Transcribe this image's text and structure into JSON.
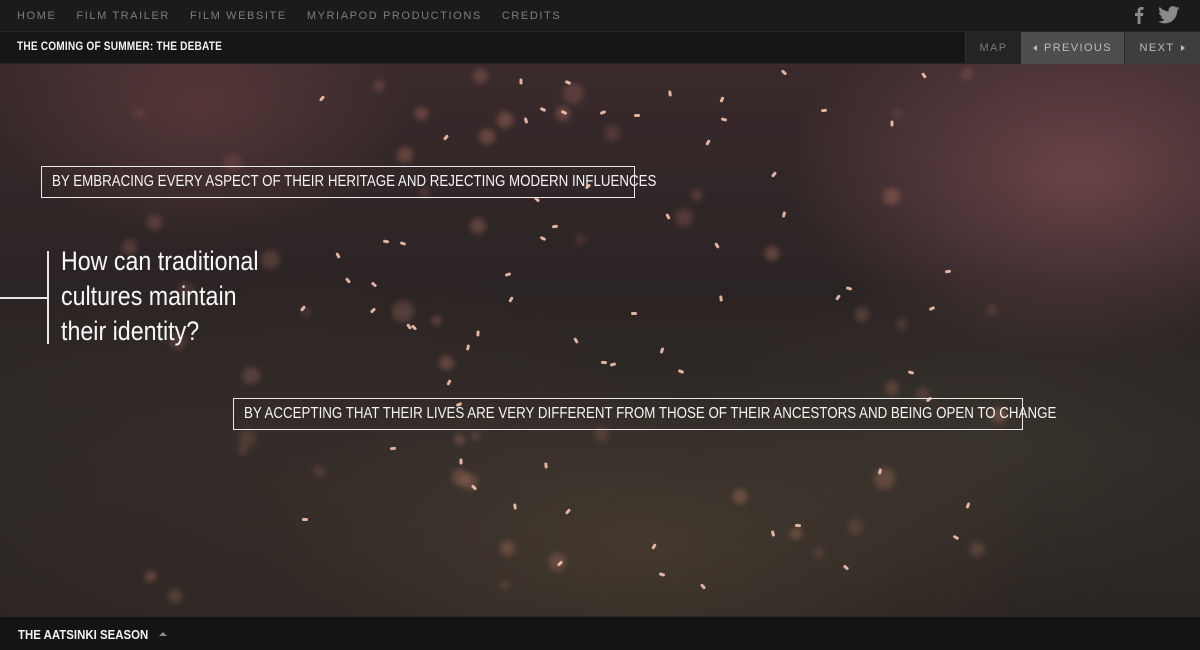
{
  "topnav": {
    "items": [
      {
        "label": "HOME"
      },
      {
        "label": "FILM TRAILER"
      },
      {
        "label": "FILM WEBSITE"
      },
      {
        "label": "MYRIAPOD PRODUCTIONS"
      },
      {
        "label": "CREDITS"
      }
    ],
    "social": [
      "facebook-icon",
      "twitter-icon"
    ]
  },
  "titlebar": {
    "title": "THE COMING OF SUMMER: THE DEBATE",
    "map_label": "MAP",
    "previous_label": "PREVIOUS",
    "next_label": "NEXT"
  },
  "debate": {
    "question": "How can traditional cultures maintain their identity?",
    "answers": [
      {
        "text": "BY EMBRACING EVERY ASPECT OF THEIR HERITAGE AND REJECTING MODERN INFLUENCES"
      },
      {
        "text": "BY ACCEPTING THAT THEIR LIVES ARE VERY DIFFERENT FROM THOSE OF THEIR ANCESTORS AND BEING OPEN TO CHANGE"
      }
    ]
  },
  "bottombar": {
    "season_label": "THE AATSINKI SEASON"
  },
  "colors": {
    "nav_bg": "#1b1b1b",
    "prev_bg": "#4e4e4e",
    "next_bg": "#3e3e3e",
    "text_light": "#f4f4f4"
  }
}
